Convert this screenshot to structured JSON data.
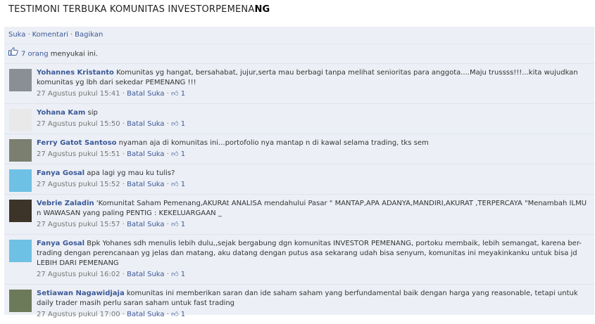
{
  "title_main": "TESTIMONI TERBUKA KOMUNITAS INVESTORPEMENA",
  "title_tail": "NG",
  "actions": {
    "like": "Suka",
    "comment": "Komentari",
    "share": "Bagikan",
    "sep": "·"
  },
  "likes": {
    "count_text": "7 orang",
    "suffix": " menyukai ini."
  },
  "comments": [
    {
      "name": "Yohannes Kristanto",
      "text": "Komunitas yg hangat, bersahabat, jujur,serta mau berbagi tanpa melihat senioritas para anggota....Maju trussss!!!...kita wujudkan komunitas yg lbh dari sekedar PEMENANG !!!",
      "time": "27 Agustus pukul 15:41",
      "unlike": "Batal Suka",
      "likes": "1",
      "avatar": "#8a8f95"
    },
    {
      "name": "Yohana Kam",
      "text": "sip",
      "time": "27 Agustus pukul 15:50",
      "unlike": "Batal Suka",
      "likes": "1",
      "avatar": "#e9e9e9"
    },
    {
      "name": "Ferry Gatot Santoso",
      "text": "nyaman aja di komunitas ini...portofolio nya mantap n di kawal selama trading, tks sem",
      "time": "27 Agustus pukul 15:51",
      "unlike": "Batal Suka",
      "likes": "1",
      "avatar": "#7a7f70"
    },
    {
      "name": "Fanya Gosal",
      "text": "apa lagi yg mau ku tulis?",
      "time": "27 Agustus pukul 15:52",
      "unlike": "Batal Suka",
      "likes": "1",
      "avatar": "#6ec1e4"
    },
    {
      "name": "Vebrie Zaladin",
      "text": "'Komunitat Saham Pemenang,AKURAt ANALISA mendahului Pasar \" MANTAP,APA ADANYA,MANDIRI,AKURAT ,TERPERCAYA \"Menambah ILMU n WAWASAN yang paling PENTIG : KEKELUARGAAN _",
      "time": "27 Agustus pukul 15:57",
      "unlike": "Batal Suka",
      "likes": "1",
      "avatar": "#3c3428"
    },
    {
      "name": "Fanya Gosal",
      "text": "Bpk Yohanes sdh menulis lebih dulu,,sejak bergabung dgn komunitas INVESTOR PEMENANG, portoku membaik, lebih semangat, karena ber-trading dengan perencanaan yg jelas dan matang, aku datang dengan putus asa sekarang udah bisa senyum, komunitas ini meyakinkanku untuk bisa jd LEBIH DARI PEMENANG",
      "time": "27 Agustus pukul 16:02",
      "unlike": "Batal Suka",
      "likes": "1",
      "avatar": "#6ec1e4"
    },
    {
      "name": "Setiawan Nagawidjaja",
      "text": "komunitas ini memberikan saran dan ide saham saham yang berfundamental baik dengan harga yang reasonable, tetapi untuk daily trader masih perlu saran saham untuk fast trading",
      "time": "27 Agustus pukul 17:00",
      "unlike": "Batal Suka",
      "likes": "1",
      "avatar": "#6d7a5a"
    }
  ]
}
